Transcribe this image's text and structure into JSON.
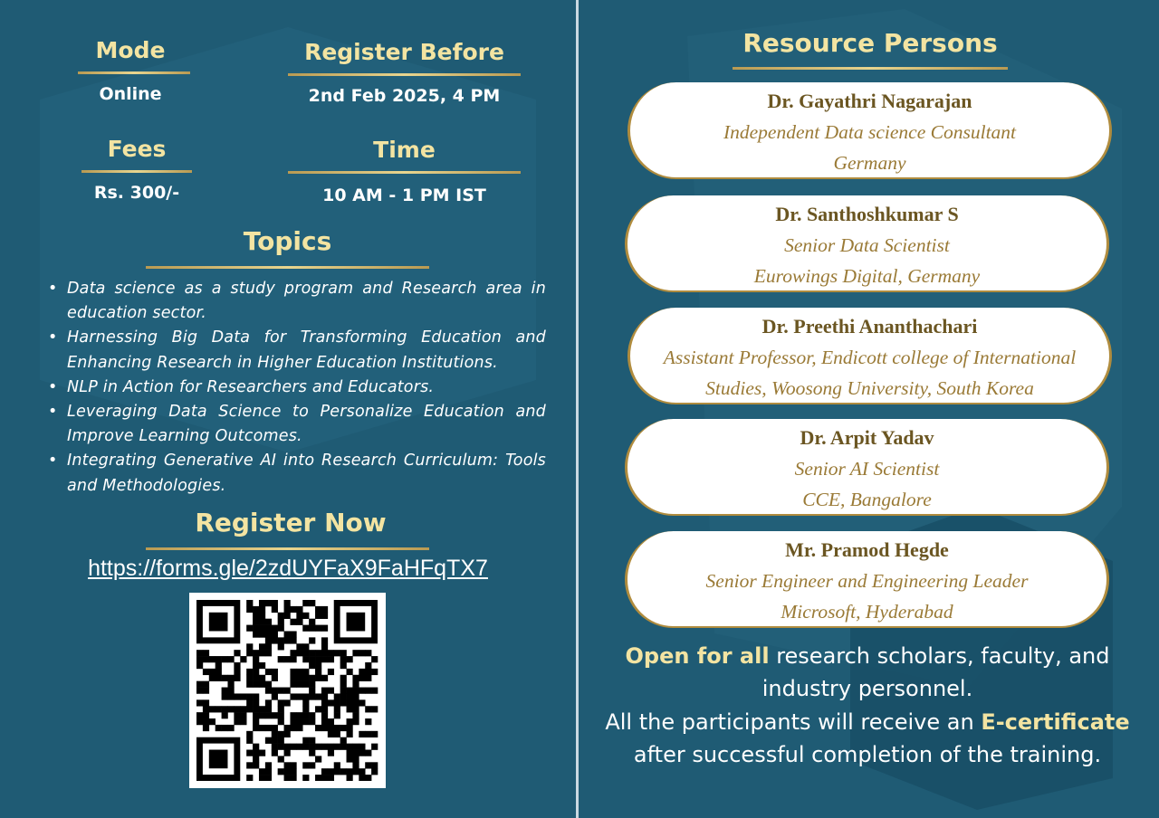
{
  "left": {
    "mode": {
      "label": "Mode",
      "value": "Online"
    },
    "register_before": {
      "label": "Register Before",
      "value": "2nd Feb 2025, 4 PM"
    },
    "fees": {
      "label": "Fees",
      "value": "Rs. 300/-"
    },
    "time": {
      "label": "Time",
      "value": "10 AM - 1 PM IST"
    },
    "topics_title": "Topics",
    "topics": [
      "Data science as a study program and Research area in education sector.",
      "Harnessing Big Data for Transforming Education and Enhancing Research in Higher Education Institutions.",
      "NLP in Action for Researchers and Educators.",
      "Leveraging Data Science to Personalize Education and Improve Learning Outcomes.",
      "Integrating Generative AI into Research Curriculum: Tools and Methodologies."
    ],
    "register_title": "Register Now",
    "register_link": "https://forms.gle/2zdUYFaX9FaHFqTX7"
  },
  "right": {
    "title": "Resource Persons",
    "persons": [
      {
        "name": "Dr. Gayathri Nagarajan",
        "line1": "Independent Data science Consultant",
        "line2": "Germany"
      },
      {
        "name": "Dr. Santhoshkumar S",
        "line1": "Senior Data Scientist",
        "line2": "Eurowings Digital, Germany"
      },
      {
        "name": "Dr. Preethi Ananthachari",
        "line1": "Assistant Professor, Endicott college of International",
        "line2": "Studies, Woosong University, South Korea"
      },
      {
        "name": "Dr. Arpit Yadav",
        "line1": "Senior AI Scientist",
        "line2": "CCE, Bangalore"
      },
      {
        "name": "Mr. Pramod Hegde",
        "line1": "Senior Engineer and Engineering Leader",
        "line2": "Microsoft, Hyderabad"
      }
    ],
    "footer": {
      "open_bold": "Open for all",
      "open_rest": " research scholars, faculty, and",
      "line2": "industry personnel.",
      "line3_pre": "All the participants will receive an ",
      "line3_bold": "E-certificate",
      "line4": "after successful completion of the training."
    }
  },
  "colors": {
    "background": "#1f5b74",
    "gold": "#f3e4a2",
    "card_text": "#8a6a28"
  }
}
